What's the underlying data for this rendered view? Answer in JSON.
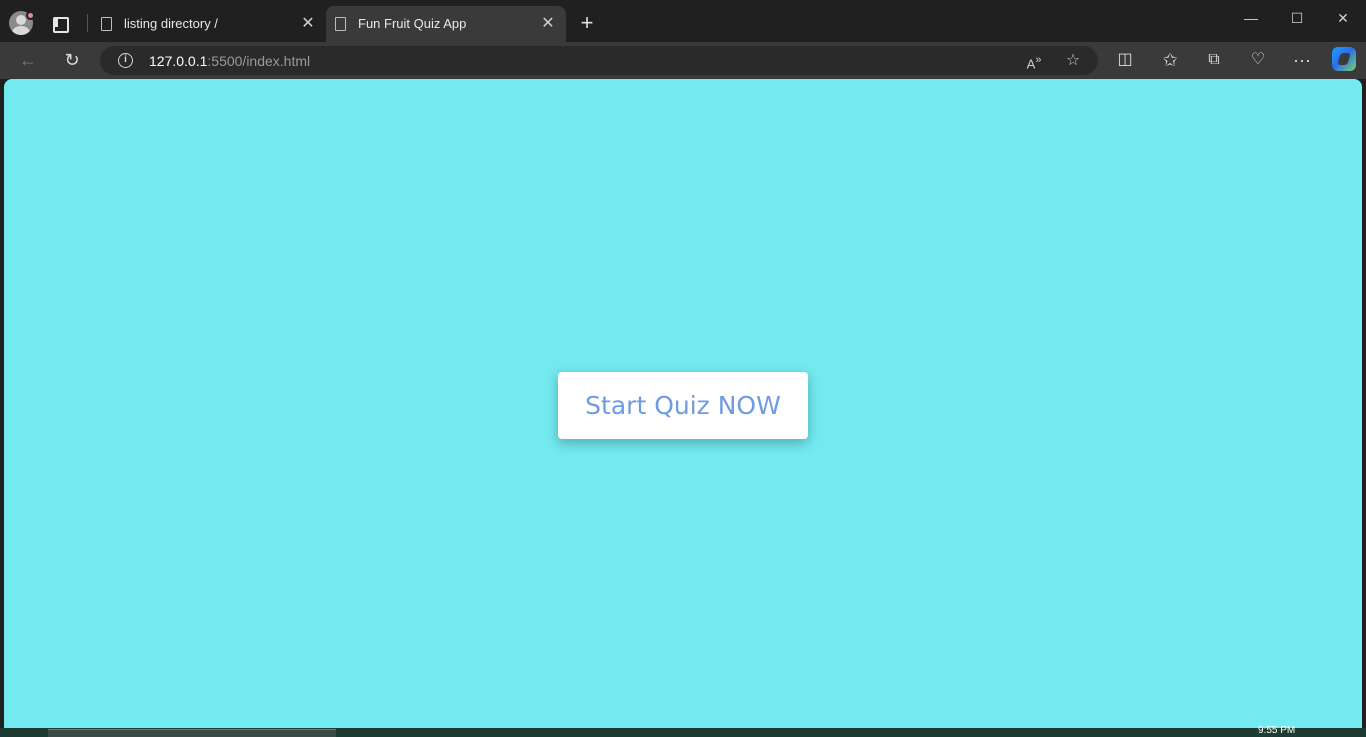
{
  "browser": {
    "tabs": [
      {
        "title": "listing directory /",
        "active": false
      },
      {
        "title": "Fun Fruit Quiz App",
        "active": true
      }
    ],
    "address": {
      "host": "127.0.0.1",
      "path": ":5500/index.html"
    },
    "window_controls": {
      "minimize": "—",
      "maximize": "☐",
      "close": "✕"
    }
  },
  "page": {
    "background_color": "#72eaf0",
    "start_button_label": "Start Quiz NOW",
    "start_button_text_color": "#6f9be3"
  },
  "taskbar": {
    "clock": "9:55 PM"
  }
}
